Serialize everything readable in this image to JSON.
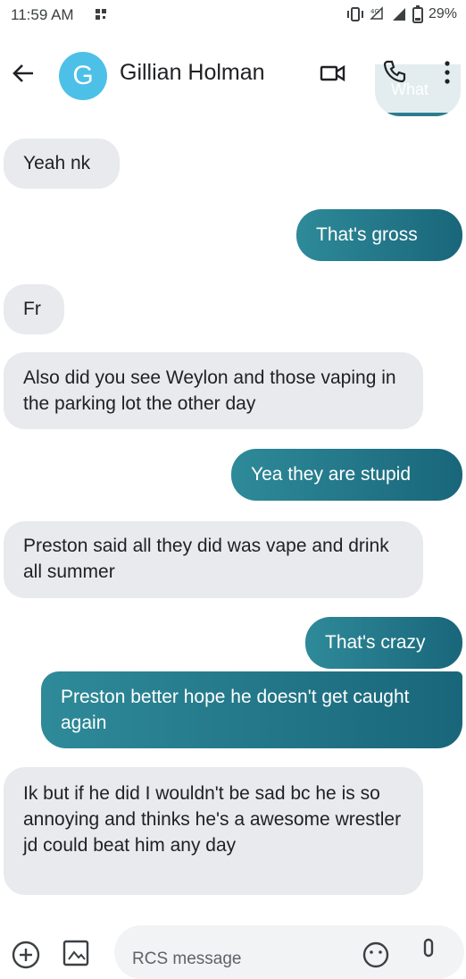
{
  "status_bar": {
    "time": "11:59 AM",
    "battery": "29%"
  },
  "header": {
    "avatar_letter": "G",
    "contact_name": "Gillian Holman",
    "avatar_color": "#4dc0e8"
  },
  "ghost_message": "What",
  "messages": [
    {
      "direction": "in",
      "text": "Yeah nk"
    },
    {
      "direction": "out",
      "text": "That's gross"
    },
    {
      "direction": "in",
      "text": "Fr"
    },
    {
      "direction": "in",
      "text": "Also did you see Weylon and  those vaping in the parking lot the other day"
    },
    {
      "direction": "out",
      "text": "Yea they are stupid"
    },
    {
      "direction": "in",
      "text": "Preston said all they did was vape and drink all summer"
    },
    {
      "direction": "out",
      "text": "That's crazy"
    },
    {
      "direction": "out",
      "text": "Preston better hope he doesn't get caught again"
    },
    {
      "direction": "in",
      "text": "Ik but if he did I wouldn't be sad bc he is so annoying and thinks he's a awesome wrestler jd could beat him any day"
    }
  ],
  "compose": {
    "placeholder": "RCS message"
  },
  "colors": {
    "incoming_bubble": "#e8eaed",
    "outgoing_bubble_start": "#2e8a99",
    "outgoing_bubble_end": "#19667a"
  }
}
